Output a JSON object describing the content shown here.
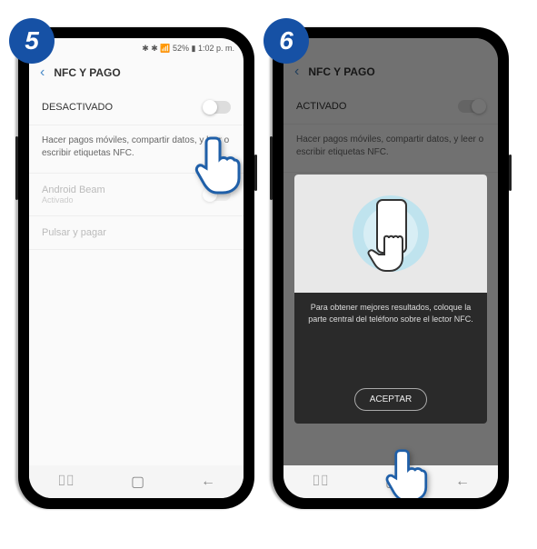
{
  "steps": {
    "s5": "5",
    "s6": "6"
  },
  "status": "✱ ✱ 📶 52% ▮ 1:02 p. m.",
  "header": {
    "title": "NFC Y PAGO"
  },
  "screen5": {
    "state": "DESACTIVADO",
    "desc": "Hacer pagos móviles, compartir datos, y leer o escribir etiquetas NFC.",
    "beam": {
      "label": "Android Beam",
      "status": "Activado"
    },
    "tap": "Pulsar y pagar"
  },
  "screen6": {
    "state": "ACTIVADO",
    "desc": "Hacer pagos móviles, compartir datos, y leer o escribir etiquetas NFC.",
    "modal": {
      "text": "Para obtener mejores resultados, coloque la parte central del teléfono sobre el lector NFC.",
      "button": "ACEPTAR"
    }
  }
}
